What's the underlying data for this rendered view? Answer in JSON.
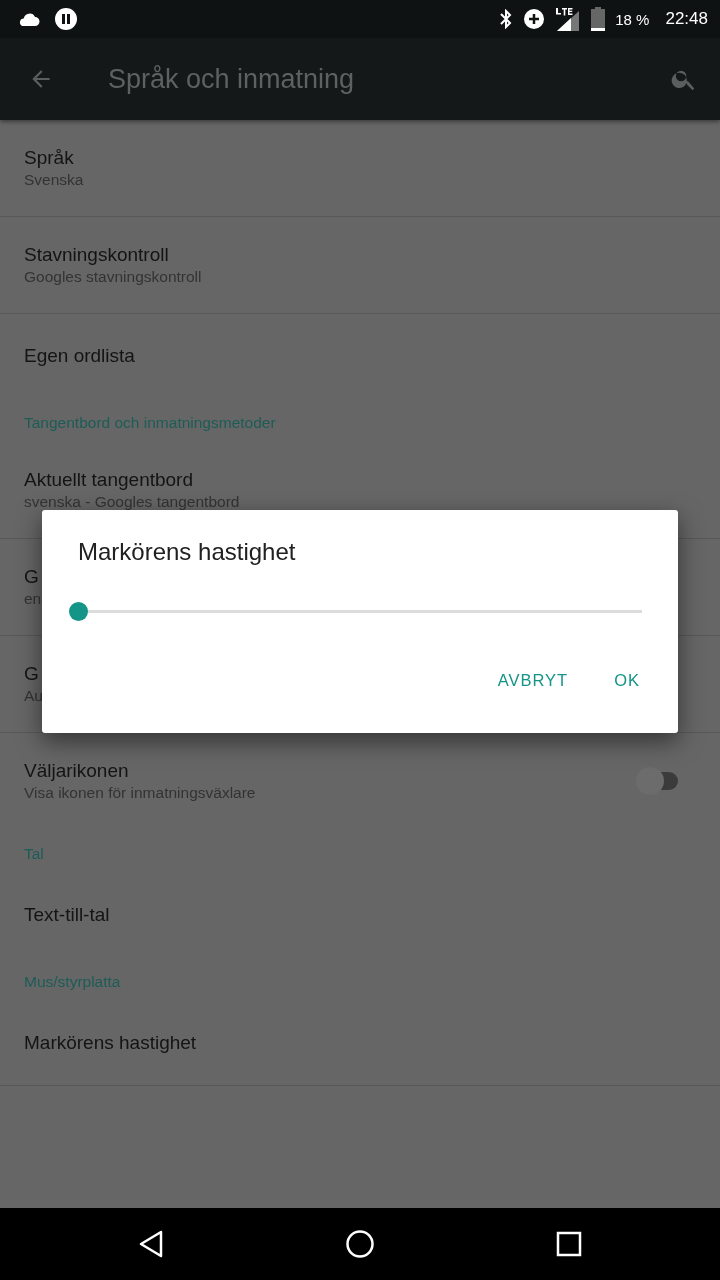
{
  "status_bar": {
    "battery": "18 %",
    "time": "22:48"
  },
  "toolbar": {
    "title": "Språk och inmatning"
  },
  "items": [
    {
      "kind": "item",
      "title": "Språk",
      "subtitle": "Svenska",
      "divider": true
    },
    {
      "kind": "item",
      "title": "Stavningskontroll",
      "subtitle": "Googles stavningskontroll",
      "divider": true
    },
    {
      "kind": "item",
      "title": "Egen ordlista",
      "divider": false
    },
    {
      "kind": "header",
      "title": "Tangentbord och inmatningsmetoder"
    },
    {
      "kind": "item",
      "title": "Aktuellt tangentbord",
      "subtitle": "svenska - Googles tangentbord",
      "divider": true
    },
    {
      "kind": "item",
      "title": "G",
      "subtitle": "en",
      "divider": true
    },
    {
      "kind": "item",
      "title": "G",
      "subtitle": "Au",
      "divider": true
    },
    {
      "kind": "switch",
      "title": "Väljarikonen",
      "subtitle": "Visa ikonen för inmatningsväxlare",
      "on": false,
      "divider": false
    },
    {
      "kind": "header",
      "title": "Tal"
    },
    {
      "kind": "item",
      "title": "Text-till-tal",
      "divider": false
    },
    {
      "kind": "header",
      "title": "Mus/styrplatta"
    },
    {
      "kind": "item",
      "title": "Markörens hastighet",
      "divider": true
    }
  ],
  "dialog": {
    "title": "Markörens hastighet",
    "slider": {
      "level": 0
    },
    "buttons": [
      "AVBRYT",
      "OK"
    ]
  }
}
